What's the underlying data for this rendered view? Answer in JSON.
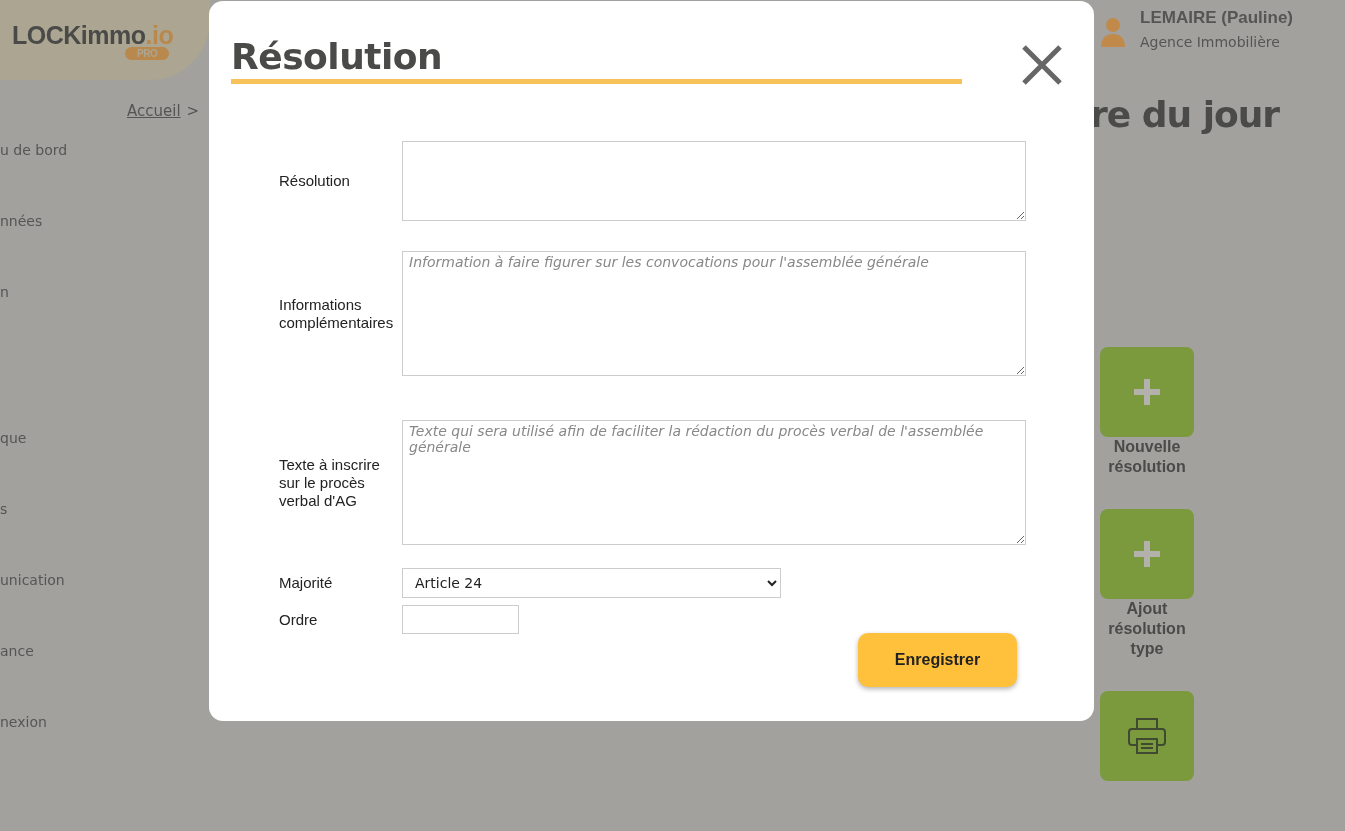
{
  "logo": {
    "name": "LOCKimmo",
    "suffix": ".io",
    "badge": "PRO"
  },
  "user": {
    "name": "LEMAIRE (Pauline)",
    "role": "Agence Immobilière"
  },
  "breadcrumb": {
    "link": "Accueil",
    "separator": ">"
  },
  "sidebar": {
    "items": [
      "u de bord",
      "nnées",
      "n",
      "que",
      "s",
      "unication",
      "ance",
      "nexion"
    ]
  },
  "page_title": "re du jour",
  "actions": [
    {
      "kind": "plus",
      "label": "Nouvelle résolution"
    },
    {
      "kind": "plus",
      "label": "Ajout résolution type"
    },
    {
      "kind": "print"
    }
  ],
  "modal": {
    "title": "Résolution",
    "fields": [
      {
        "kind": "textarea",
        "label": "Résolution"
      },
      {
        "kind": "textarea",
        "label": "Informations complémentaires",
        "placeholder": "Information à faire figurer sur les convocations pour l'assemblée générale"
      },
      {
        "kind": "textarea",
        "label": "Texte à inscrire sur le procès verbal d'AG",
        "placeholder": "Texte qui sera utilisé afin de faciliter la rédaction du procès verbal de l'assemblée générale"
      },
      {
        "kind": "select",
        "label": "Majorité",
        "value": "Article 24"
      },
      {
        "kind": "input",
        "label": "Ordre"
      }
    ],
    "submit": "Enregistrer"
  }
}
